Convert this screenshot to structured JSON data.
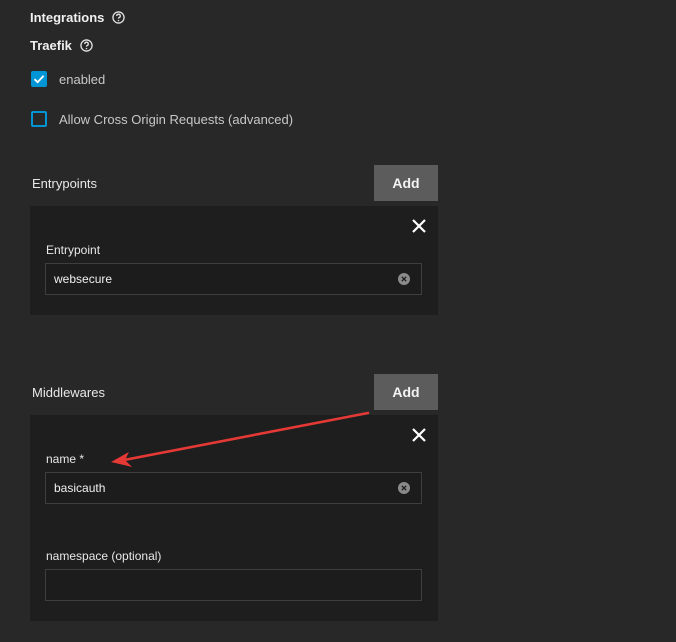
{
  "integrations": {
    "heading": "Integrations",
    "help_icon": "help-circle-icon"
  },
  "traefik": {
    "heading": "Traefik",
    "help_icon": "help-circle-icon",
    "enabled_label": "enabled",
    "enabled_checked": true,
    "cors_label": "Allow Cross Origin Requests (advanced)",
    "cors_checked": false
  },
  "entrypoints": {
    "title": "Entrypoints",
    "add_label": "Add",
    "items": [
      {
        "label": "Entrypoint",
        "value": "websecure"
      }
    ]
  },
  "middlewares": {
    "title": "Middlewares",
    "add_label": "Add",
    "items": [
      {
        "name_label": "name",
        "required_marker": "*",
        "name_value": "basicauth",
        "namespace_label": "namespace (optional)",
        "namespace_value": ""
      }
    ]
  },
  "colors": {
    "background": "#282828",
    "card": "#1e1e1e",
    "accent": "#0095d5",
    "button": "#5c5c5c",
    "annotation_arrow": "#e53935"
  },
  "icons": {
    "close": "close-icon",
    "clear": "clear-circle-icon",
    "check": "check-icon",
    "arrow": "red-arrow-annotation-icon"
  }
}
